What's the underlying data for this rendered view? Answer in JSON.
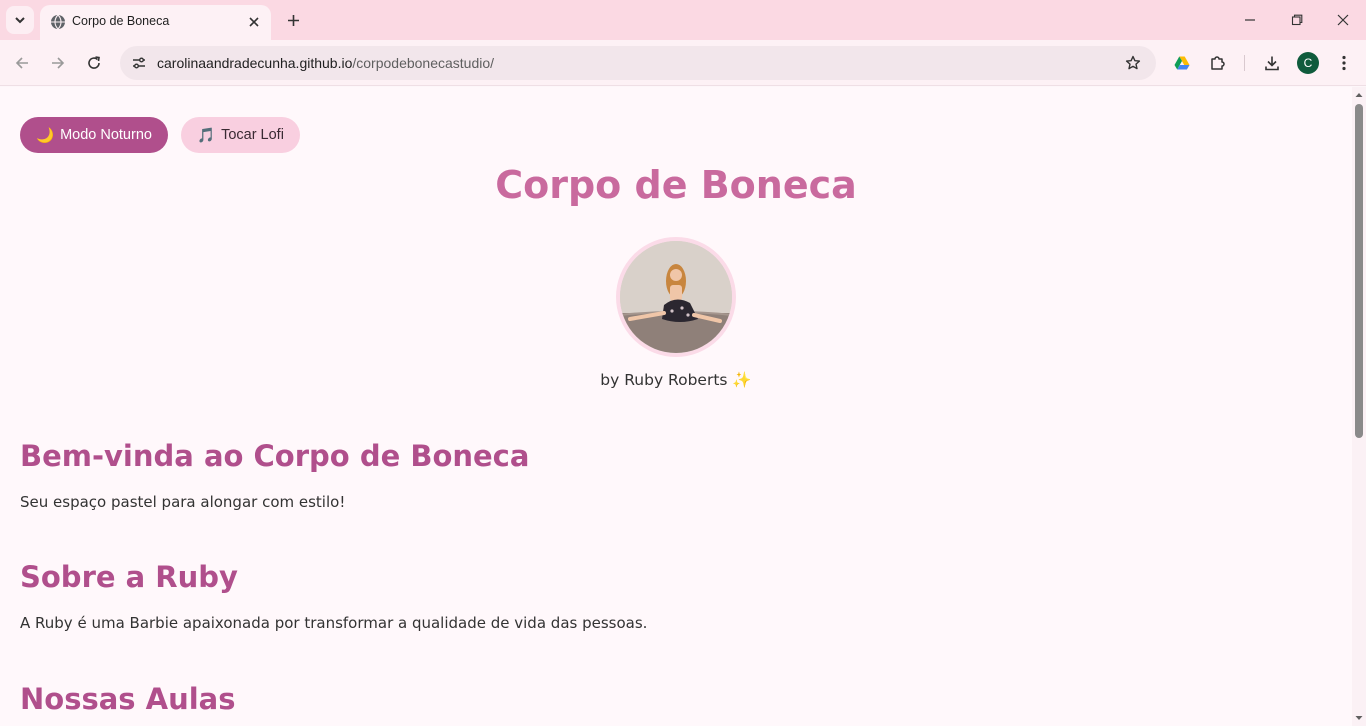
{
  "browser": {
    "tab_title": "Corpo de Boneca",
    "url_domain": "carolinaandradecunha.github.io",
    "url_path": "/corpodebonecastudio/",
    "profile_initial": "C",
    "accent_color": "#b04f8c"
  },
  "controls": {
    "night_mode": {
      "icon": "🌙",
      "label": "Modo Noturno"
    },
    "lofi": {
      "icon": "🎵",
      "label": "Tocar Lofi"
    }
  },
  "header": {
    "title": "Corpo de Boneca",
    "byline": "by Ruby Roberts ✨"
  },
  "sections": [
    {
      "heading": "Bem-vinda ao Corpo de Boneca",
      "text": "Seu espaço pastel para alongar com estilo!"
    },
    {
      "heading": "Sobre a Ruby",
      "text": "A Ruby é uma Barbie apaixonada por transformar a qualidade de vida das pessoas."
    },
    {
      "heading": "Nossas Aulas",
      "text": ""
    }
  ]
}
